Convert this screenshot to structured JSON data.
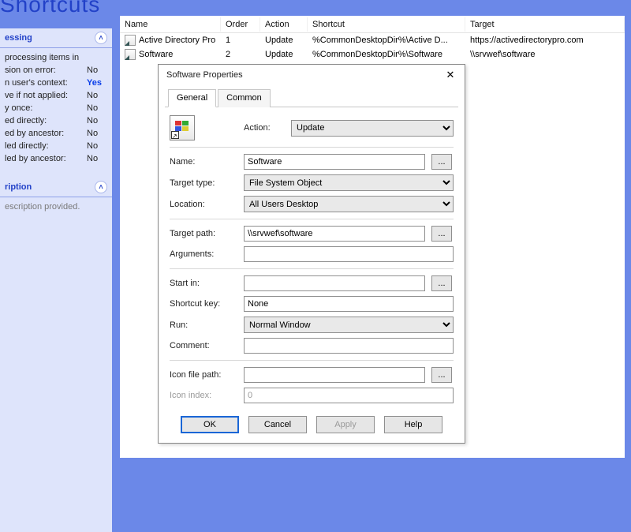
{
  "page_title": "Shortcuts",
  "left": {
    "processing_head": "essing",
    "processing_rows": [
      {
        "label": "processing items in",
        "value": ""
      },
      {
        "label": "sion on error:",
        "value": "No"
      },
      {
        "label": "n user's context:",
        "value": "Yes"
      },
      {
        "label": "ve if not applied:",
        "value": "No"
      },
      {
        "label": "y once:",
        "value": "No"
      },
      {
        "label": "ed directly:",
        "value": "No"
      },
      {
        "label": "ed by ancestor:",
        "value": "No"
      },
      {
        "label": "led directly:",
        "value": "No"
      },
      {
        "label": "led by ancestor:",
        "value": "No"
      }
    ],
    "description_head": "ription",
    "description_body": "escription provided."
  },
  "table": {
    "columns": [
      "Name",
      "Order",
      "Action",
      "Shortcut",
      "Target"
    ],
    "rows": [
      {
        "name": "Active Directory Pro",
        "order": "1",
        "action": "Update",
        "shortcut": "%CommonDesktopDir%\\Active D...",
        "target": "https://activedirectorypro.com"
      },
      {
        "name": "Software",
        "order": "2",
        "action": "Update",
        "shortcut": "%CommonDesktopDir%\\Software",
        "target": "\\\\srvwef\\software"
      }
    ]
  },
  "dialog": {
    "title": "Software Properties",
    "tabs": {
      "general": "General",
      "common": "Common"
    },
    "labels": {
      "action": "Action:",
      "name": "Name:",
      "target_type": "Target type:",
      "location": "Location:",
      "target_path": "Target path:",
      "arguments": "Arguments:",
      "start_in": "Start in:",
      "shortcut_key": "Shortcut key:",
      "run": "Run:",
      "comment": "Comment:",
      "icon_file_path": "Icon file path:",
      "icon_index": "Icon index:"
    },
    "values": {
      "action": "Update",
      "name": "Software",
      "target_type": "File System Object",
      "location": "All Users Desktop",
      "target_path": "\\\\srvwef\\software",
      "arguments": "",
      "start_in": "",
      "shortcut_key": "None",
      "run": "Normal Window",
      "comment": "",
      "icon_file_path": "",
      "icon_index": "0"
    },
    "browse": "...",
    "buttons": {
      "ok": "OK",
      "cancel": "Cancel",
      "apply": "Apply",
      "help": "Help"
    }
  }
}
